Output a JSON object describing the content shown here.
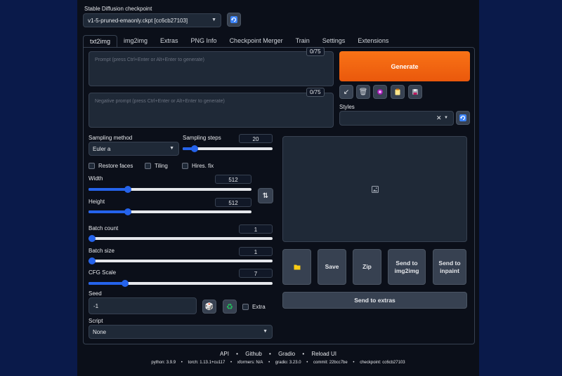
{
  "checkpoint": {
    "label": "Stable Diffusion checkpoint",
    "value": "v1-5-pruned-emaonly.ckpt [cc6cb27103]"
  },
  "tabs": [
    "txt2img",
    "img2img",
    "Extras",
    "PNG Info",
    "Checkpoint Merger",
    "Train",
    "Settings",
    "Extensions"
  ],
  "prompt": {
    "placeholder": "Prompt (press Ctrl+Enter or Alt+Enter to generate)",
    "counter": "0/75"
  },
  "negative_prompt": {
    "placeholder": "Negative prompt (press Ctrl+Enter or Alt+Enter to generate)",
    "counter": "0/75"
  },
  "generate_label": "Generate",
  "styles_label": "Styles",
  "sampling": {
    "method_label": "Sampling method",
    "method_value": "Euler a",
    "steps_label": "Sampling steps",
    "steps_value": "20",
    "steps_fraction": 0.13
  },
  "checkboxes": {
    "restore_faces": "Restore faces",
    "tiling": "Tiling",
    "hires_fix": "Hires. fix",
    "extra": "Extra"
  },
  "width": {
    "label": "Width",
    "value": "512",
    "fraction": 0.24
  },
  "height": {
    "label": "Height",
    "value": "512",
    "fraction": 0.24
  },
  "batch_count": {
    "label": "Batch count",
    "value": "1",
    "fraction": 0.0
  },
  "batch_size": {
    "label": "Batch size",
    "value": "1",
    "fraction": 0.0
  },
  "cfg_scale": {
    "label": "CFG Scale",
    "value": "7",
    "fraction": 0.2
  },
  "seed": {
    "label": "Seed",
    "value": "-1"
  },
  "script": {
    "label": "Script",
    "value": "None"
  },
  "output_buttons": {
    "save": "Save",
    "zip": "Zip",
    "send_img2img": "Send to img2img",
    "send_inpaint": "Send to inpaint",
    "send_extras": "Send to extras"
  },
  "footer": {
    "links": [
      "API",
      "Github",
      "Gradio",
      "Reload UI"
    ],
    "separator": "•",
    "versions": [
      "python: 3.9.9",
      "torch: 1.13.1+cu117",
      "xformers: N/A",
      "gradio: 3.23.0",
      "commit: 22bcc7be",
      "checkpoint: cc6cb27103"
    ]
  },
  "colors": {
    "background": "#0a1a4a",
    "panel": "#0b0f19",
    "accent": "#2563eb",
    "generate": "#f97316"
  }
}
